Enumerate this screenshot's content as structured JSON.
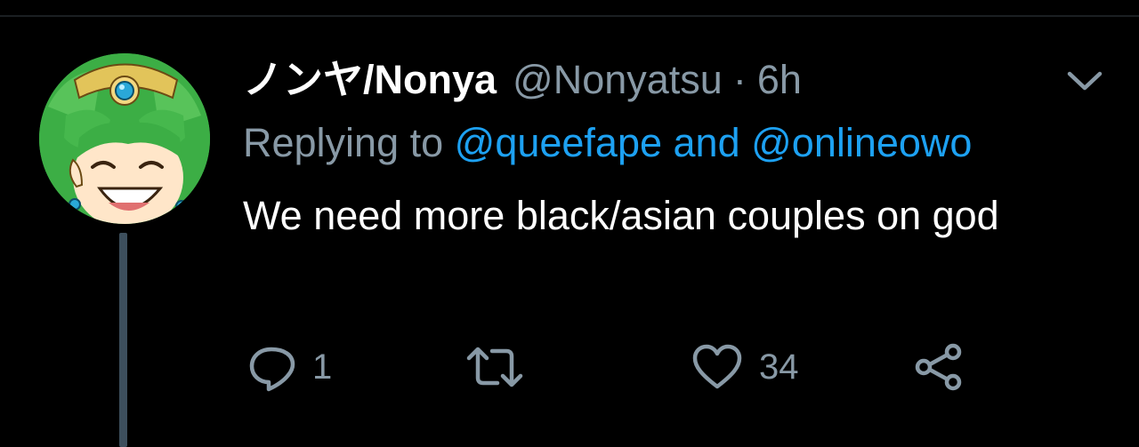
{
  "tweet": {
    "display_name": "ノンヤ/Nonya",
    "handle": "@Nonyatsu",
    "separator": "·",
    "time": "6h",
    "replying_prefix": "Replying to ",
    "reply_mention_1": "@queefape",
    "reply_conjunction": " and ",
    "reply_mention_2": "@onlineowo",
    "text": "We need more black/asian couples on god"
  },
  "actions": {
    "reply_icon": "reply-icon",
    "reply_count": "1",
    "retweet_icon": "retweet-icon",
    "retweet_count": "",
    "like_icon": "heart-icon",
    "like_count": "34",
    "share_icon": "share-icon"
  },
  "colors": {
    "background": "#000000",
    "muted": "#8899a6",
    "link": "#1da1f2",
    "thread_line": "#3d4f5d"
  }
}
